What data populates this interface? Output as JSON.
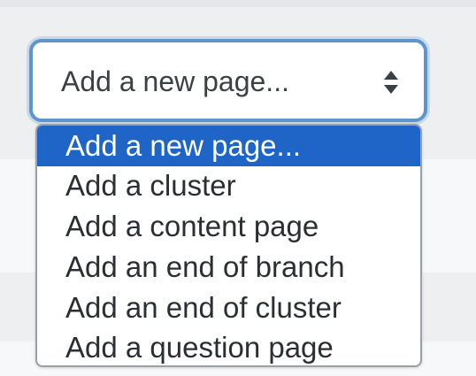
{
  "select": {
    "current_value": "Add a new page...",
    "caret_icon": "up-down-caret-icon",
    "focus_border_color": "#5c96d2"
  },
  "dropdown": {
    "highlight_color": "#1f64c7",
    "options": [
      {
        "label": "Add a new page...",
        "selected": true
      },
      {
        "label": "Add a cluster",
        "selected": false
      },
      {
        "label": "Add a content page",
        "selected": false
      },
      {
        "label": "Add an end of branch",
        "selected": false
      },
      {
        "label": "Add an end of cluster",
        "selected": false
      },
      {
        "label": "Add a question page",
        "selected": false
      }
    ]
  }
}
